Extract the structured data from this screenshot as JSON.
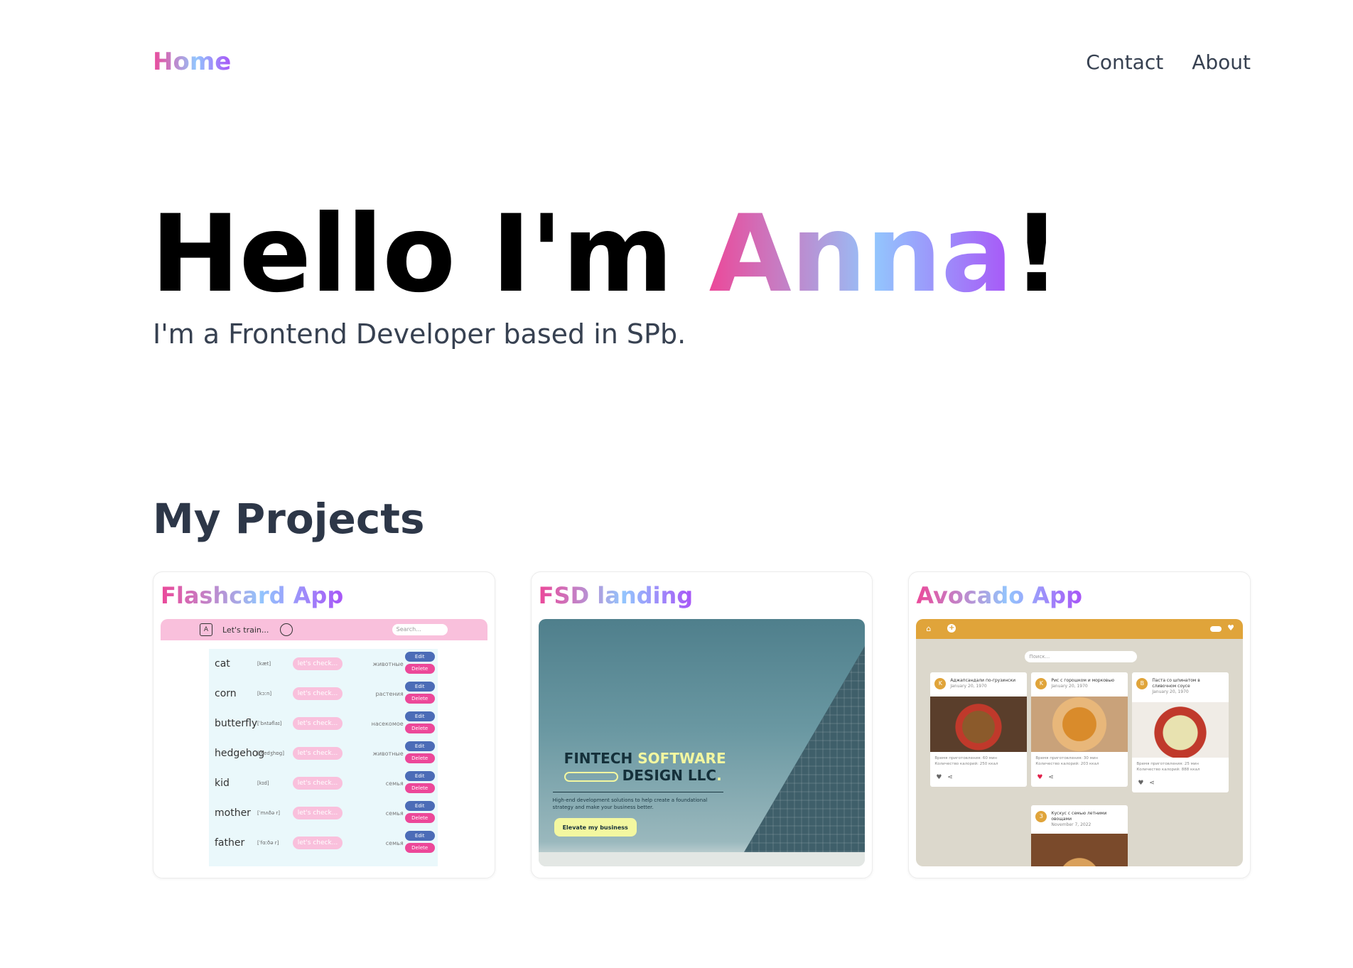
{
  "nav": {
    "home_label": "Home",
    "contact_label": "Contact",
    "about_label": "About"
  },
  "hero": {
    "greeting": "Hello I'm ",
    "name": "Anna",
    "exclamation": "!",
    "subtitle": "I'm a Frontend Developer based in SPb."
  },
  "projects": {
    "heading": "My Projects",
    "cards": [
      {
        "title": "Flashcard App",
        "preview": {
          "bar_label": "Let's train...",
          "search_placeholder": "Search...",
          "rows": [
            {
              "word": "cat",
              "transcription": "[kæt]",
              "check": "let's check...",
              "category": "животные",
              "edit": "Edit",
              "delete": "Delete"
            },
            {
              "word": "corn",
              "transcription": "[kɔːn]",
              "check": "let's check...",
              "category": "растения",
              "edit": "Edit",
              "delete": "Delete"
            },
            {
              "word": "butterfly",
              "transcription": "[ˈbʌtəflaɪ]",
              "check": "let's check...",
              "category": "насекомое",
              "edit": "Edit",
              "delete": "Delete"
            },
            {
              "word": "hedgehog",
              "transcription": "[ˈhedʒhɒɡ]",
              "check": "let's check...",
              "category": "животные",
              "edit": "Edit",
              "delete": "Delete"
            },
            {
              "word": "kid",
              "transcription": "[kɪd]",
              "check": "let's check...",
              "category": "семья",
              "edit": "Edit",
              "delete": "Delete"
            },
            {
              "word": "mother",
              "transcription": "[ˈmʌðə r]",
              "check": "let's check...",
              "category": "семья",
              "edit": "Edit",
              "delete": "Delete"
            },
            {
              "word": "father",
              "transcription": "[ˈfɑːðə r]",
              "check": "let's check...",
              "category": "семья",
              "edit": "Edit",
              "delete": "Delete"
            }
          ]
        }
      },
      {
        "title": "FSD landing",
        "preview": {
          "headline_dark_1": "FINTECH ",
          "headline_yellow": "SOFTWARE",
          "headline_dark_2": "DESIGN LLC",
          "headline_dot": ".",
          "body": "High-end development solutions to help create a foundational strategy and make your business better.",
          "button": "Elevate my business"
        }
      },
      {
        "title": "Avocado App",
        "preview": {
          "search_placeholder": "Поиск...",
          "recipes": [
            {
              "avatar": "K",
              "title": "Аджапсандали по-грузински",
              "date": "January 20, 1970",
              "meta_1": "Время приготовления: 60 мин",
              "meta_2": "Количество калорий: 250 ккал"
            },
            {
              "avatar": "K",
              "title": "Рис с горошком и морковью",
              "date": "January 20, 1970",
              "meta_1": "Время приготовления: 30 мин",
              "meta_2": "Количество калорий: 203 ккал"
            },
            {
              "avatar": "B",
              "title": "Паста со шпинатом в сливочном соусе",
              "date": "January 20, 1970",
              "meta_1": "Время приготовления: 25 мин",
              "meta_2": "Количество калорий: 888 ккал"
            },
            {
              "avatar": "З",
              "title": "Кускус с семью летними овощами",
              "date": "November 7, 2022"
            }
          ]
        }
      }
    ]
  },
  "colors": {
    "gradient_pink": "#ec4899",
    "gradient_blue": "#93c5fd",
    "gradient_purple": "#a855f7",
    "text_dark": "#374151"
  }
}
